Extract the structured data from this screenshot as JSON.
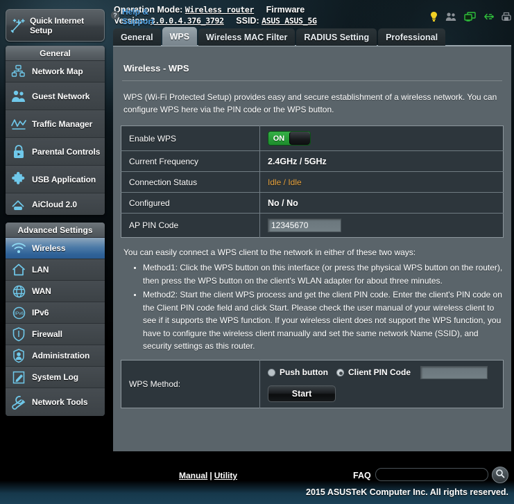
{
  "sidebar": {
    "quick_setup": {
      "label": "Quick Internet Setup",
      "icon": "wand-icon"
    },
    "general_header": "General",
    "general_items": [
      {
        "label": "Network Map",
        "icon": "network-map-icon"
      },
      {
        "label": "Guest Network",
        "icon": "guest-network-icon"
      },
      {
        "label": "Traffic Manager",
        "icon": "traffic-manager-icon"
      },
      {
        "label": "Parental Controls",
        "icon": "lock-icon"
      },
      {
        "label": "USB Application",
        "icon": "puzzle-icon"
      },
      {
        "label": "AiCloud 2.0",
        "icon": "cloud-home-icon"
      }
    ],
    "advanced_header": "Advanced Settings",
    "advanced_items": [
      {
        "label": "Wireless",
        "icon": "wifi-icon",
        "active": true
      },
      {
        "label": "LAN",
        "icon": "home-icon",
        "active": false
      },
      {
        "label": "WAN",
        "icon": "globe-icon",
        "active": false
      },
      {
        "label": "IPv6",
        "icon": "ipv6-icon",
        "active": false
      },
      {
        "label": "Firewall",
        "icon": "shield-icon",
        "active": false
      },
      {
        "label": "Administration",
        "icon": "user-icon",
        "active": false
      },
      {
        "label": "System Log",
        "icon": "pencil-note-icon",
        "active": false
      },
      {
        "label": "Network Tools",
        "icon": "wrench-icon",
        "active": false
      }
    ]
  },
  "topbar": {
    "operation_mode_label": "Operation Mode:",
    "operation_mode_value": "Wireless router",
    "firmware_label": "Firmware Version:",
    "firmware_value": "3.0.0.4.376_3792",
    "ssid_label": "SSID:",
    "ssid_value": "ASUS ASUS_5G",
    "icons": [
      {
        "name": "alert-bulb-icon",
        "color": "#f2d024"
      },
      {
        "name": "guest-users-icon",
        "color": "#8b9197"
      },
      {
        "name": "clients-monitor-icon",
        "color": "#2fbf3a"
      },
      {
        "name": "usb-icon",
        "color": "#2fbf3a"
      },
      {
        "name": "printer-icon",
        "color": "#8b9197"
      }
    ]
  },
  "tabs": [
    {
      "label": "General",
      "active": false
    },
    {
      "label": "WPS",
      "active": true
    },
    {
      "label": "Wireless MAC Filter",
      "active": false
    },
    {
      "label": "RADIUS Setting",
      "active": false
    },
    {
      "label": "Professional",
      "active": false
    }
  ],
  "main": {
    "title": "Wireless - WPS",
    "intro": "WPS (Wi-Fi Protected Setup) provides easy and secure establishment of a wireless network. You can configure WPS here via the PIN code or the WPS button.",
    "settings": [
      {
        "key": "Enable WPS",
        "type": "toggle",
        "value": "ON"
      },
      {
        "key": "Current Frequency",
        "type": "text",
        "value": "2.4GHz / 5GHz"
      },
      {
        "key": "Connection Status",
        "type": "status",
        "value": "Idle / Idle"
      },
      {
        "key": "Configured",
        "type": "text",
        "value": "No / No"
      },
      {
        "key": "AP PIN Code",
        "type": "input",
        "value": "12345670"
      }
    ],
    "methods_intro": "You can easily connect a WPS client to the network in either of these two ways:",
    "methods": [
      "Method1: Click the WPS button on this interface (or press the physical WPS button on the router), then press the WPS button on the client's WLAN adapter for about three minutes.",
      "Method2: Start the client WPS process and get the client PIN code. Enter the client's PIN code on the Client PIN code field and click Start. Please check the user manual of your wireless client to see if it supports the WPS function. If your wireless client does not support the WPS function, you have to configure the wireless client manually and set the same network Name (SSID), and security settings as this router."
    ],
    "wps_method": {
      "label": "WPS Method:",
      "push_button_label": "Push button",
      "push_button_selected": true,
      "client_pin_label": "Client PIN Code",
      "client_pin_selected": false,
      "client_pin_value": "",
      "start_label": "Start"
    }
  },
  "footer": {
    "help_support": "Help & Support",
    "manual": "Manual",
    "separator": "|",
    "utility": "Utility",
    "faq_label": "FAQ",
    "faq_value": "",
    "search_icon": "magnifier-icon",
    "copyright": "2015 ASUSTeK Computer Inc. All rights reserved."
  },
  "colors": {
    "accent_blue": "#2f6298",
    "panel_gray": "#5a646a",
    "row_dark": "#2d363c",
    "status_amber": "#e8a33d",
    "toggle_green": "#1f8b2e",
    "link_blue": "#4d9fe0"
  }
}
